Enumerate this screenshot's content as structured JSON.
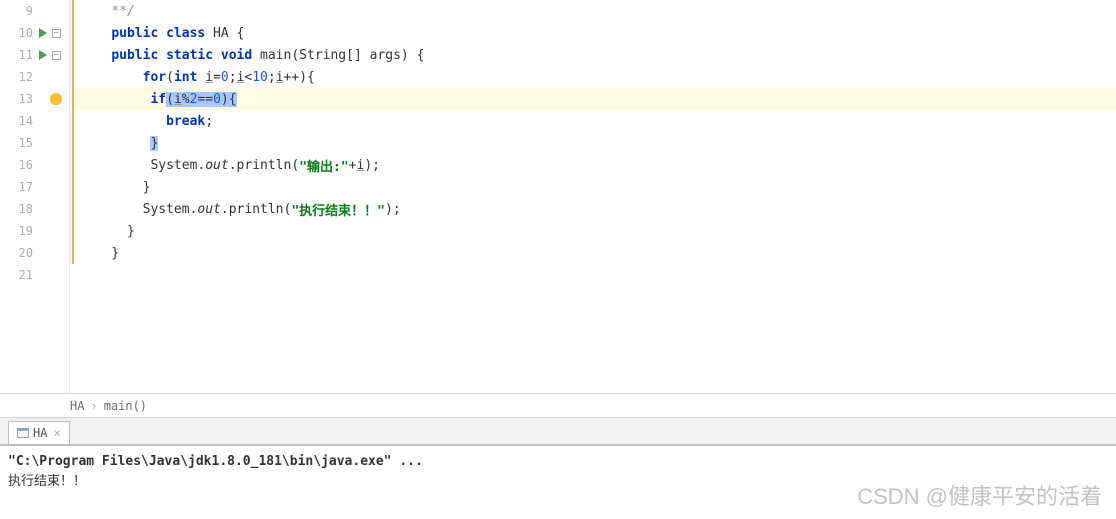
{
  "gutter": {
    "lines": [
      "9",
      "10",
      "11",
      "12",
      "13",
      "14",
      "15",
      "16",
      "17",
      "18",
      "19",
      "20",
      "21"
    ]
  },
  "code": {
    "l9": "    **/",
    "l10": {
      "indent": "    ",
      "k1": "public class",
      "rest": " HA {"
    },
    "l11": {
      "indent": "    ",
      "k1": "public static void",
      "mid": " main(String[] args) {"
    },
    "l12": {
      "indent": "        ",
      "k1": "for",
      "p1": "(",
      "k2": "int",
      "sp": " ",
      "v1": "i",
      "eq": "=",
      "n0": "0",
      "sc1": ";",
      "v2": "i",
      "lt": "<",
      "n10": "10",
      "sc2": ";",
      "v3": "i",
      "pp": "++",
      "p2": "){"
    },
    "l13": {
      "indent": "         ",
      "k1": "if",
      "sel_open": "(",
      "v1": "i",
      "mod": "%",
      "n2": "2",
      "eq": "==",
      "n0": "0",
      "sel_close": "){"
    },
    "l14": {
      "indent": "           ",
      "k1": "break",
      "sc": ";"
    },
    "l15": {
      "indent": "         ",
      "close": "}"
    },
    "l16": {
      "indent": "         System.",
      "it": "out",
      "mid": ".println(",
      "str": "\"输出:\"",
      "plus": "+",
      "v": "i",
      "end": ");"
    },
    "l17": "        }",
    "l18": {
      "indent": "        System.",
      "it": "out",
      "mid": ".println(",
      "str": "\"执行结束！！\"",
      "end": ");"
    },
    "l19": "      }",
    "l20": "    }",
    "l21": ""
  },
  "breadcrumb": {
    "item1": "HA",
    "sep": "›",
    "item2": "main()"
  },
  "console": {
    "tab_label": "HA",
    "cmd": "\"C:\\Program Files\\Java\\jdk1.8.0_181\\bin\\java.exe\" ...",
    "out1": "执行结束！！"
  },
  "watermark": "CSDN @健康平安的活着"
}
